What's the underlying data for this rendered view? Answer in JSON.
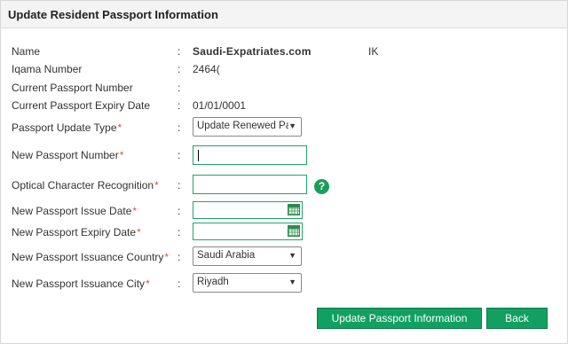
{
  "header": {
    "title": "Update Resident Passport Information"
  },
  "form": {
    "name": {
      "label": "Name",
      "colon": ":",
      "value": "Saudi-Expatriates.com",
      "suffix": "IK"
    },
    "iqama": {
      "label": "Iqama Number",
      "colon": ":",
      "value": "2464("
    },
    "current_passport": {
      "label": "Current Passport Number",
      "colon": ":"
    },
    "current_expiry": {
      "label": "Current Passport Expiry Date",
      "colon": ":",
      "value": "01/01/0001"
    },
    "update_type": {
      "label": "Passport Update Type",
      "required": "*",
      "colon": ":",
      "value": "Update Renewed Pa"
    },
    "new_number": {
      "label": "New Passport Number",
      "required": "*",
      "colon": ":"
    },
    "ocr": {
      "label": "Optical Character Recognition",
      "required": "*",
      "colon": ":",
      "help": "?"
    },
    "issue_date": {
      "label": "New Passport Issue Date",
      "required": "*",
      "colon": ":"
    },
    "expiry_date": {
      "label": "New Passport Expiry Date",
      "required": "*",
      "colon": ":"
    },
    "country": {
      "label": "New Passport Issuance Country",
      "required": "*",
      "colon": ":",
      "value": "Saudi Arabia"
    },
    "city": {
      "label": "New Passport Issuance City",
      "required": "*",
      "colon": ":",
      "value": "Riyadh"
    }
  },
  "buttons": {
    "update": "Update Passport Information",
    "back": "Back"
  },
  "icons": {
    "dropdown": "▼"
  },
  "colors": {
    "accent": "#11a060",
    "required": "#d9534f"
  }
}
